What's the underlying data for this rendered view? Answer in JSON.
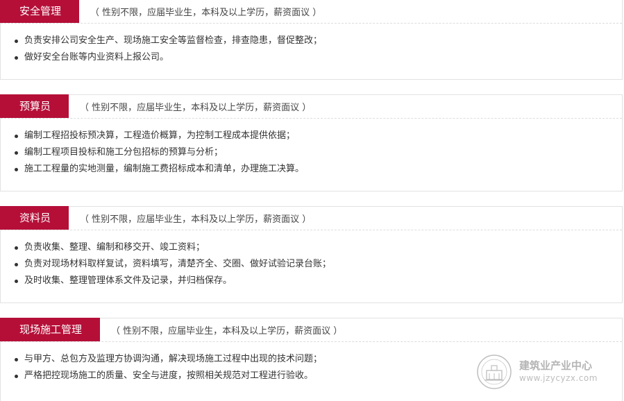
{
  "jobs": [
    {
      "title": "安全管理",
      "requirements": "（ 性别不限，应届毕业生，本科及以上学历，薪资面议 ）",
      "duties": [
        "负责安排公司安全生产、现场施工安全等监督检查，排查隐患，督促整改；",
        "做好安全台账等内业资料上报公司。"
      ]
    },
    {
      "title": "预算员",
      "requirements": "（ 性别不限，应届毕业生，本科及以上学历，薪资面议 ）",
      "duties": [
        "编制工程招投标预决算，工程造价概算，为控制工程成本提供依据；",
        "编制工程项目投标和施工分包招标的预算与分析；",
        "施工工程量的实地测量，编制施工费招标成本和清单，办理施工决算。"
      ]
    },
    {
      "title": "资料员",
      "requirements": "（ 性别不限，应届毕业生，本科及以上学历，薪资面议 ）",
      "duties": [
        "负责收集、整理、编制和移交开、竣工资料；",
        "负责对现场材料取样复试，资料填写，清楚齐全、交圈、做好试验记录台账；",
        "及时收集、整理管理体系文件及记录，并归档保存。"
      ]
    },
    {
      "title": "现场施工管理",
      "requirements": "（ 性别不限，应届毕业生，本科及以上学历，薪资面议 ）",
      "duties": [
        "与甲方、总包方及监理方协调沟通，解决现场施工过程中出现的技术问题；",
        "严格把控现场施工的质量、安全与进度，按照相关规范对工程进行验收。"
      ]
    }
  ],
  "watermark": {
    "name": "建筑业产业中心",
    "url": "www.jzycyzx.com",
    "seal_icon": "building-seal-icon"
  },
  "colors": {
    "accent": "#b50f38",
    "border": "#e2e2e2",
    "text": "#333333"
  }
}
